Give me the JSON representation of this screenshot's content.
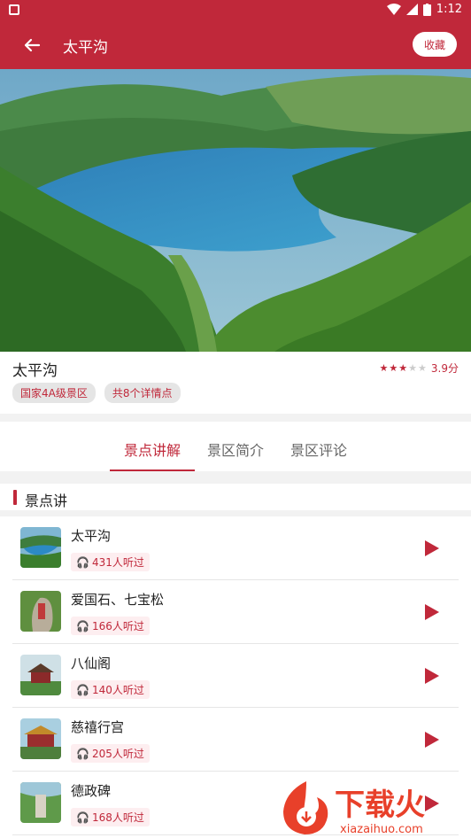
{
  "status": {
    "time": "1:12"
  },
  "header": {
    "title": "太平沟",
    "favorite_label": "收藏"
  },
  "info": {
    "name": "太平沟",
    "rating": "3.9分",
    "rating_stars": 3,
    "tags": [
      "国家4A级景区",
      "共8个详情点"
    ]
  },
  "tabs": [
    {
      "label": "景点讲解",
      "active": true
    },
    {
      "label": "景区简介",
      "active": false
    },
    {
      "label": "景区评论",
      "active": false
    }
  ],
  "section": {
    "title": "景点讲"
  },
  "spots": [
    {
      "name": "太平沟",
      "listens": "431人听过"
    },
    {
      "name": "爱国石、七宝松",
      "listens": "166人听过"
    },
    {
      "name": "八仙阁",
      "listens": "140人听过"
    },
    {
      "name": "慈禧行宫",
      "listens": "205人听过"
    },
    {
      "name": "德政碑",
      "listens": "168人听过"
    }
  ],
  "watermark": {
    "brand": "下载火",
    "url": "xiazaihuo.com"
  },
  "colors": {
    "primary": "#c0283a"
  }
}
